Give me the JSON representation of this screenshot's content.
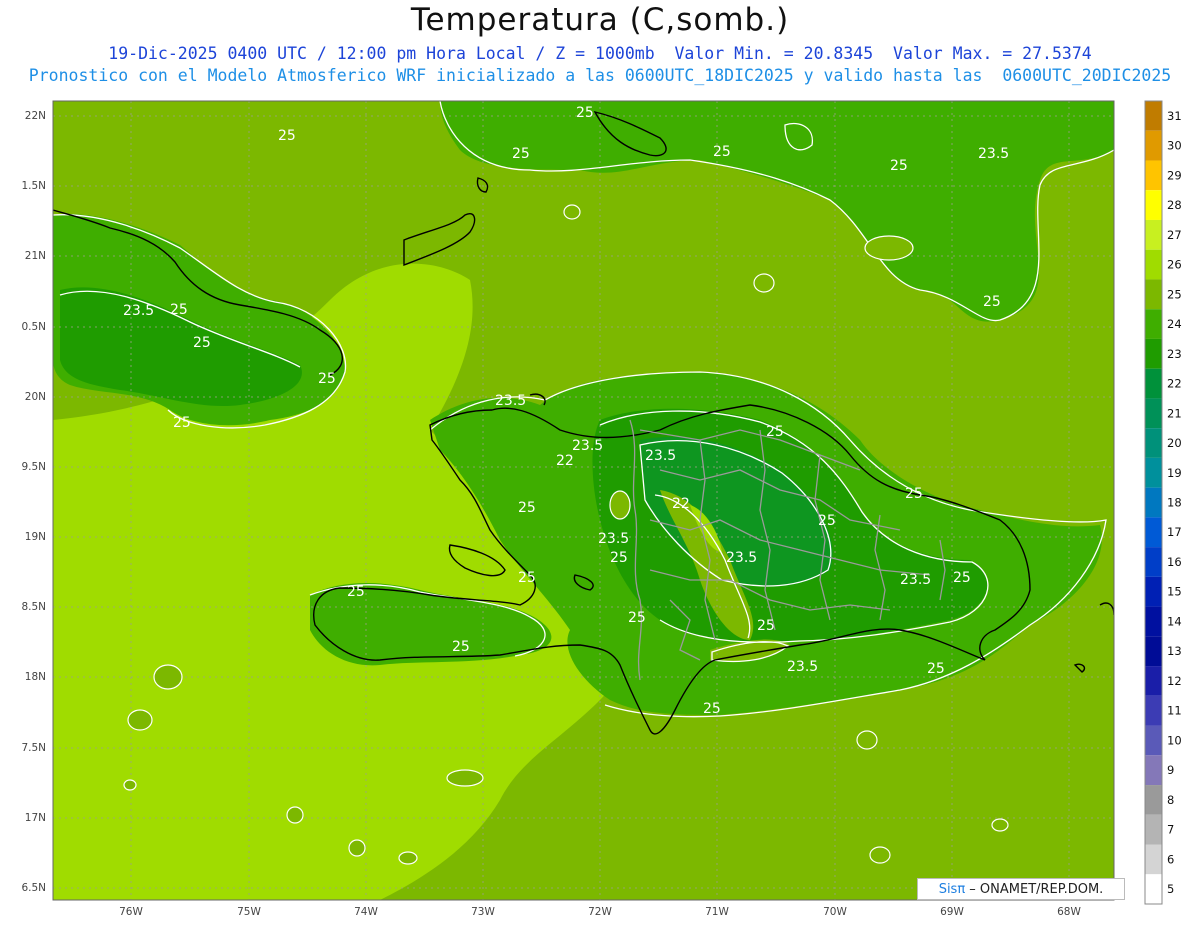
{
  "title": "Temperatura (C,somb.)",
  "subtitle1": "19-Dic-2025 0400 UTC / 12:00 pm Hora Local / Z = 1000mb  Valor Min. = 20.8345  Valor Max. = 27.5374",
  "subtitle2": "Pronostico con el Modelo Atmosferico WRF inicializado a las 0600UTC_18DIC2025 y valido hasta las  0600UTC_20DIC2025",
  "lat_labels": [
    "22N",
    "1.5N",
    "21N",
    "0.5N",
    "20N",
    "9.5N",
    "19N",
    "8.5N",
    "18N",
    "7.5N",
    "17N",
    "6.5N"
  ],
  "lon_labels": [
    "76W",
    "75W",
    "74W",
    "73W",
    "72W",
    "71W",
    "70W",
    "69W",
    "68W"
  ],
  "colorbar": {
    "levels": [
      "31",
      "30",
      "29",
      "28",
      "27",
      "26",
      "25",
      "24",
      "23",
      "22",
      "21",
      "20",
      "19",
      "18",
      "17",
      "16",
      "15",
      "14",
      "13",
      "12",
      "11",
      "10",
      "9",
      "8",
      "7",
      "6",
      "5"
    ],
    "colors": [
      "#c07c00",
      "#e09a00",
      "#ffc400",
      "#ffff00",
      "#c8f020",
      "#a0dc00",
      "#7cb800",
      "#3fae00",
      "#1f9c00",
      "#00913a",
      "#009158",
      "#00917a",
      "#00909c",
      "#0078c0",
      "#005ad6",
      "#003ec8",
      "#0020b4",
      "#0010a0",
      "#000c96",
      "#1a1ea8",
      "#3c3cb4",
      "#5a5ab8",
      "#8478b8",
      "#9a9a9a",
      "#b4b4b4",
      "#d4d4d4",
      "#ffffff"
    ]
  },
  "contour_labels": [
    "25",
    "25",
    "25",
    "25",
    "25",
    "23.5",
    "25",
    "23.5",
    "25",
    "25",
    "25",
    "25",
    "23.5",
    "23.5",
    "22",
    "23.5",
    "25",
    "25",
    "22",
    "25",
    "25",
    "23.5",
    "25",
    "23.5",
    "23.5",
    "25",
    "25",
    "25",
    "25",
    "25",
    "23.5",
    "25",
    "25",
    "25",
    "25",
    "25"
  ],
  "credit": {
    "brand": "Sisπ",
    "text": " – ONAMET/REP.DOM."
  }
}
